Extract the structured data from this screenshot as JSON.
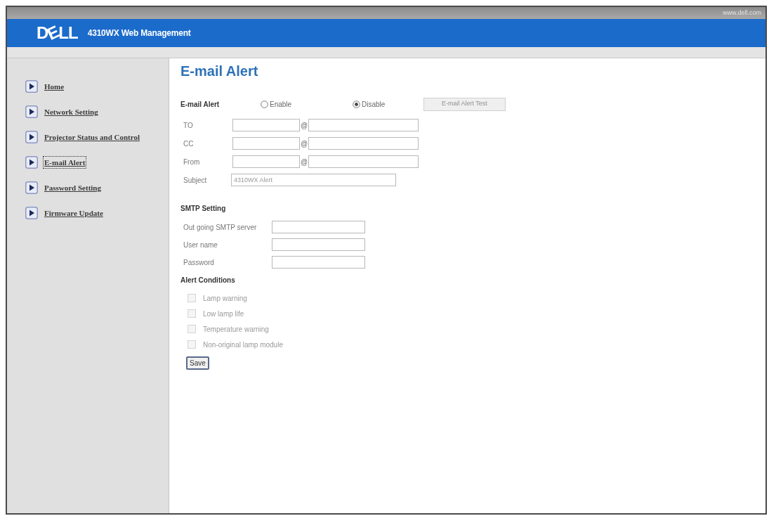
{
  "header": {
    "site_link": "www.dell.com",
    "logo": "DELL",
    "title": "4310WX Web Management"
  },
  "sidebar": {
    "items": [
      {
        "label": "Home",
        "selected": false
      },
      {
        "label": "Network Setting",
        "selected": false
      },
      {
        "label": "Projector Status and Control",
        "selected": false
      },
      {
        "label": "E-mail Alert",
        "selected": true
      },
      {
        "label": "Password Setting",
        "selected": false
      },
      {
        "label": "Firmware Update",
        "selected": false
      }
    ]
  },
  "page": {
    "title": "E-mail Alert"
  },
  "email_alert": {
    "label": "E-mail Alert",
    "options": [
      {
        "label": "Enable",
        "selected": false
      },
      {
        "label": "Disable",
        "selected": true
      }
    ],
    "test_button": {
      "label": "E-mail Alert Test",
      "disabled": true
    }
  },
  "recipients": [
    {
      "label": "TO",
      "separator": "@"
    },
    {
      "label": "CC",
      "separator": "@"
    },
    {
      "label": "From",
      "separator": "@"
    }
  ],
  "subject": {
    "label": "Subject",
    "value": "4310WX Alert"
  },
  "smtp": {
    "title": "SMTP Setting",
    "fields": [
      {
        "label": "Out going SMTP server"
      },
      {
        "label": "User name"
      },
      {
        "label": "Password"
      }
    ]
  },
  "alert_conditions": {
    "title": "Alert Conditions",
    "items": [
      {
        "label": "Lamp warning",
        "checked": false,
        "disabled": true
      },
      {
        "label": "Low lamp life",
        "checked": false,
        "disabled": true
      },
      {
        "label": "Temperature warning",
        "checked": false,
        "disabled": true
      },
      {
        "label": "Non-original lamp module",
        "checked": false,
        "disabled": true
      }
    ]
  },
  "save_button": "Save"
}
